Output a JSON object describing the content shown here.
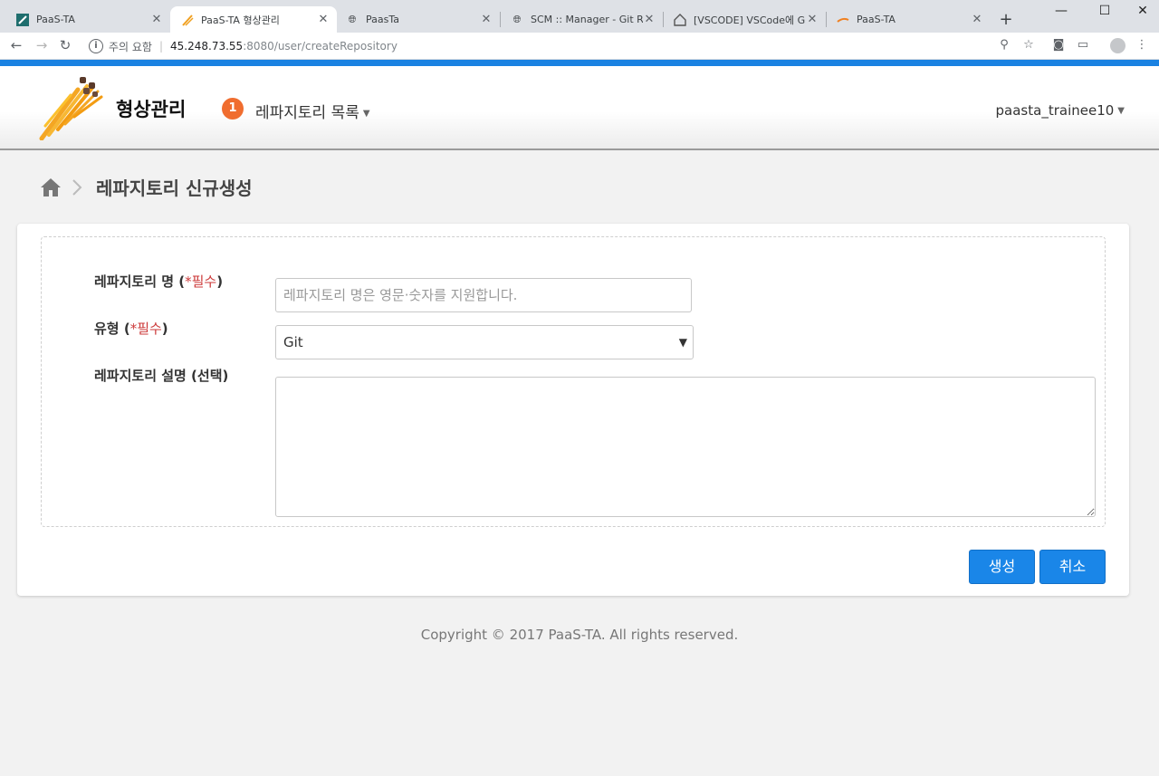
{
  "browser": {
    "tabs": [
      {
        "title": "PaaS-TA",
        "icon": "paasta-icon",
        "active": false
      },
      {
        "title": "PaaS-TA 형상관리",
        "icon": "paasta-scm-icon",
        "active": true
      },
      {
        "title": "PaasTa",
        "icon": "globe-icon",
        "active": false
      },
      {
        "title": "SCM :: Manager - Git Repo",
        "icon": "globe-icon",
        "active": false
      },
      {
        "title": "[VSCODE] VSCode에 Git 사",
        "icon": "blog-icon",
        "active": false
      },
      {
        "title": "PaaS-TA",
        "icon": "paasta-icon",
        "active": false
      }
    ],
    "address": {
      "security_text": "주의 요함",
      "host": "45.248.73.55",
      "path": ":8080/user/createRepository"
    }
  },
  "header": {
    "brand": "형상관리",
    "nav_badge": "1",
    "nav_menu": "레파지토리 목록",
    "user": "paasta_trainee10"
  },
  "breadcrumb": {
    "title": "레파지토리 신규생성"
  },
  "form": {
    "name_label": "레파지토리 명",
    "required_label": "*필수",
    "name_placeholder": "레파지토리 명은 영문·숫자를 지원합니다.",
    "type_label": "유형",
    "type_value": "Git",
    "desc_label": "레파지토리 설명 (선택)",
    "create_button": "생성",
    "cancel_button": "취소"
  },
  "footer": {
    "copyright": "Copyright © 2017 PaaS-TA. All rights reserved."
  },
  "colors": {
    "accent": "#1a86e8",
    "badge": "#f06d2f",
    "required": "#cc3a3a"
  }
}
